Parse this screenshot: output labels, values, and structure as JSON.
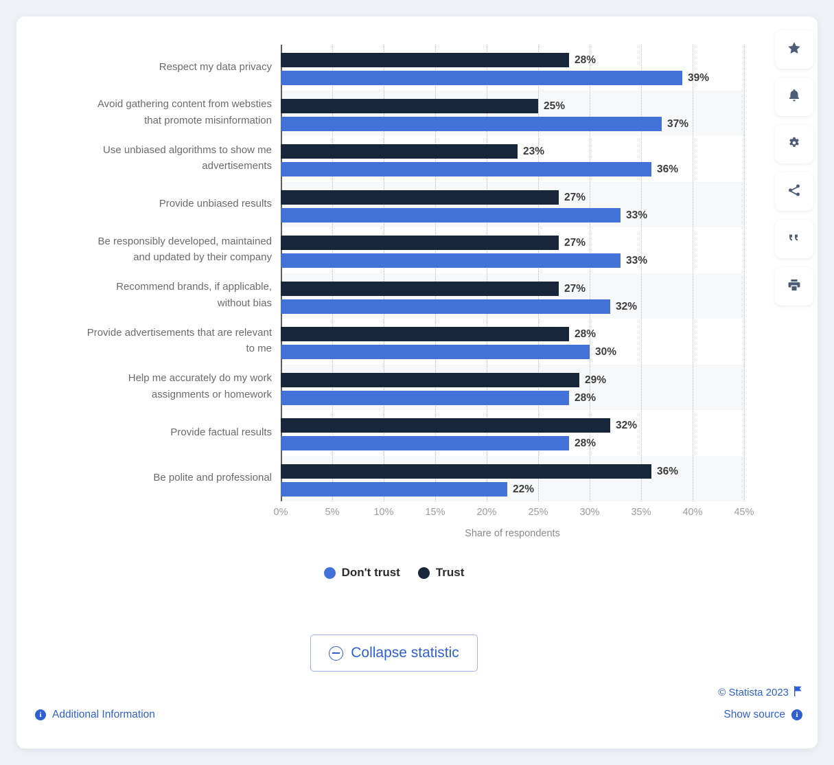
{
  "chart_data": {
    "type": "bar",
    "orientation": "horizontal",
    "title": "",
    "xlabel": "Share of respondents",
    "ylabel": "",
    "xlim": [
      0,
      45
    ],
    "xticks": [
      "0%",
      "5%",
      "10%",
      "15%",
      "20%",
      "25%",
      "30%",
      "35%",
      "40%",
      "45%"
    ],
    "xtick_values": [
      0,
      5,
      10,
      15,
      20,
      25,
      30,
      35,
      40,
      45
    ],
    "grid": true,
    "legend_position": "bottom-center",
    "categories": [
      "Respect my data privacy",
      "Avoid gathering content from websties that promote misinformation",
      "Use unbiased algorithms to show me advertisements",
      "Provide unbiased results",
      "Be responsibly developed, maintained and updated by their company",
      "Recommend brands, if applicable, without bias",
      "Provide advertisements that are relevant to me",
      "Help me accurately do my work assignments or homework",
      "Provide factual results",
      "Be polite and professional"
    ],
    "category_lines": [
      [
        "Respect my data privacy"
      ],
      [
        "Avoid gathering content from websties",
        "that promote misinformation"
      ],
      [
        "Use unbiased algorithms to show me",
        "advertisements"
      ],
      [
        "Provide unbiased results"
      ],
      [
        "Be responsibly developed, maintained",
        "and updated by their company"
      ],
      [
        "Recommend brands, if applicable,",
        "without bias"
      ],
      [
        "Provide advertisements that are relevant",
        "to me"
      ],
      [
        "Help me accurately do my work",
        "assignments or homework"
      ],
      [
        "Provide factual results"
      ],
      [
        "Be polite and professional"
      ]
    ],
    "series": [
      {
        "name": "Trust",
        "color": "#18263c",
        "values": [
          28,
          25,
          23,
          27,
          27,
          27,
          28,
          29,
          32,
          36
        ],
        "labels": [
          "28%",
          "25%",
          "23%",
          "27%",
          "27%",
          "27%",
          "28%",
          "29%",
          "32%",
          "36%"
        ]
      },
      {
        "name": "Don't trust",
        "color": "#4272d8",
        "values": [
          39,
          37,
          36,
          33,
          33,
          32,
          30,
          28,
          28,
          22
        ],
        "labels": [
          "39%",
          "37%",
          "36%",
          "33%",
          "33%",
          "32%",
          "30%",
          "28%",
          "28%",
          "22%"
        ]
      }
    ]
  },
  "legend": {
    "items": [
      {
        "label": "Don't trust",
        "color": "#4272d8"
      },
      {
        "label": "Trust",
        "color": "#18263c"
      }
    ]
  },
  "collapse": {
    "label": "Collapse statistic",
    "icon": "circle-minus-icon"
  },
  "footer": {
    "copyright": "© Statista 2023",
    "flag_icon": "flag-icon",
    "additional_information": "Additional Information",
    "show_source": "Show source",
    "info_glyph": "i"
  },
  "sidebar": {
    "items": [
      {
        "name": "star-icon"
      },
      {
        "name": "bell-icon"
      },
      {
        "name": "gear-icon"
      },
      {
        "name": "share-icon"
      },
      {
        "name": "quote-icon"
      },
      {
        "name": "print-icon"
      }
    ]
  },
  "colors": {
    "trust": "#18263c",
    "dont_trust": "#4272d8",
    "accent": "#2f5fd0",
    "band": "#f7f8f9"
  }
}
